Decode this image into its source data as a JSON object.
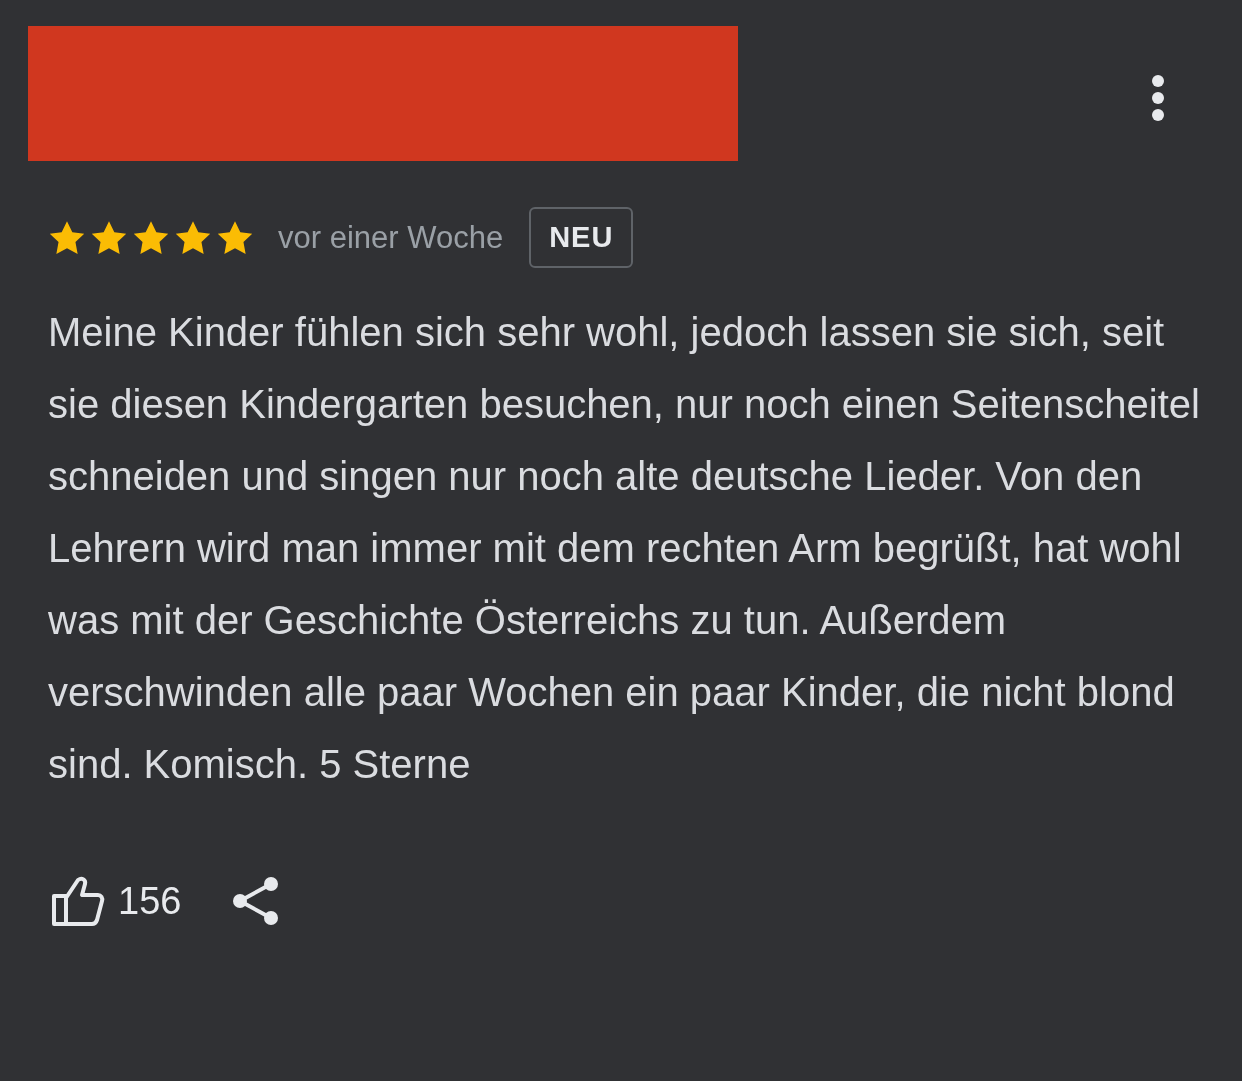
{
  "review": {
    "author_redacted": true,
    "stars": 5,
    "time": "vor einer Woche",
    "badge": "NEU",
    "text": "Meine Kinder fühlen sich sehr wohl, jedoch lassen sie sich, seit sie diesen Kindergarten besuchen, nur noch einen Seitenscheitel schneiden und singen nur noch alte deutsche Lieder. Von den Lehrern wird man immer mit dem rechten Arm begrüßt, hat wohl was mit der Geschichte Österreichs zu tun. Außerdem verschwinden alle paar Wochen ein paar Kinder, die nicht blond sind. Komisch. 5 Sterne",
    "likes": "156"
  }
}
